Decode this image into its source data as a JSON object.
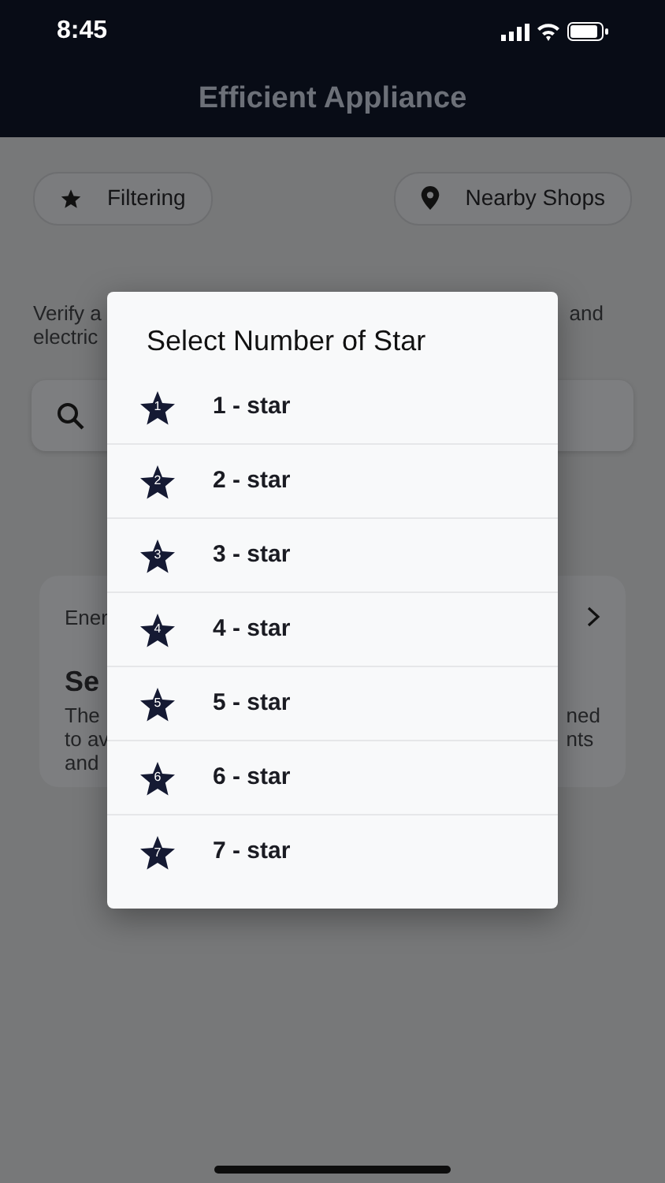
{
  "status_bar": {
    "time": "8:45"
  },
  "header": {
    "title": "Efficient Appliance"
  },
  "chips": [
    {
      "label": "Filtering",
      "kind": "star"
    },
    {
      "label": "Nearby Shops",
      "kind": "pin"
    }
  ],
  "intro": {
    "left_lines": [
      "Verify a",
      "electric"
    ],
    "right_lines": [
      "and"
    ]
  },
  "card": {
    "category": "Ener",
    "title": "Se",
    "left_lines": [
      "The",
      "to av",
      "and"
    ],
    "right_lines": [
      "ned",
      "nts"
    ]
  },
  "dialog": {
    "title": "Select Number of Star",
    "options": [
      {
        "number": "1",
        "label": "1 - star"
      },
      {
        "number": "2",
        "label": "2 - star"
      },
      {
        "number": "3",
        "label": "3 - star"
      },
      {
        "number": "4",
        "label": "4 - star"
      },
      {
        "number": "5",
        "label": "5 - star"
      },
      {
        "number": "6",
        "label": "6 - star"
      },
      {
        "number": "7",
        "label": "7 - star"
      }
    ]
  }
}
